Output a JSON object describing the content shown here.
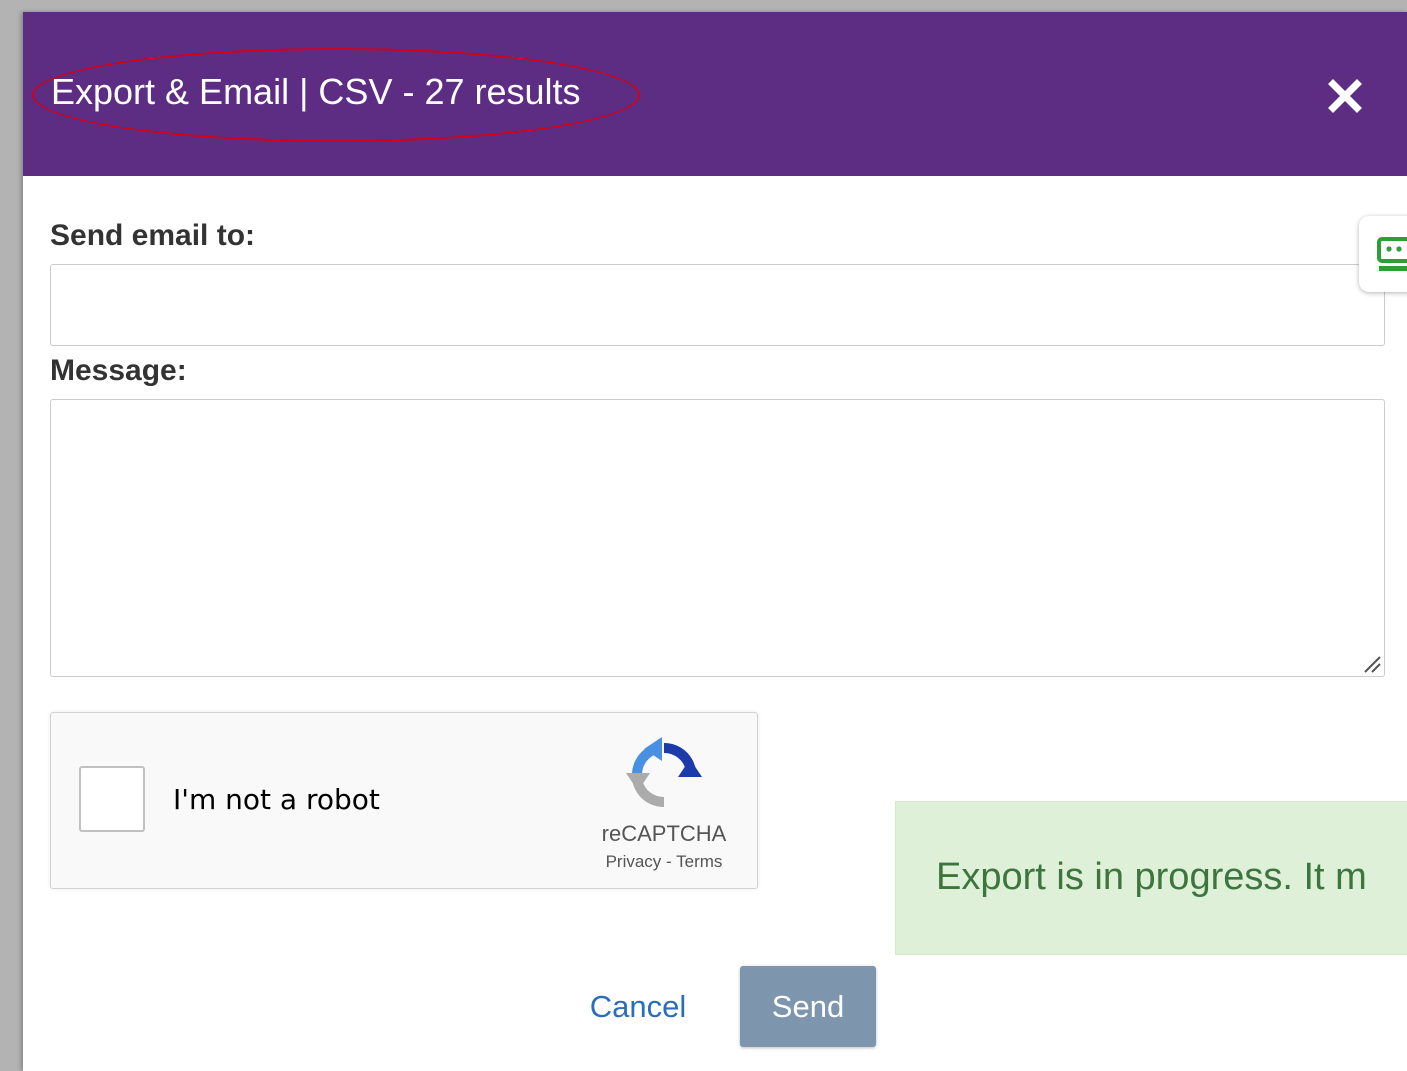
{
  "dialog": {
    "title": "Export & Email | CSV - 27 results",
    "accent_color": "#5c2d82",
    "close_icon": "close-icon"
  },
  "form": {
    "email_label": "Send email to:",
    "email_value": "",
    "email_placeholder": "",
    "message_label": "Message:",
    "message_value": "",
    "message_placeholder": ""
  },
  "recaptcha": {
    "label": "I'm not a robot",
    "brand": "reCAPTCHA",
    "privacy": "Privacy",
    "separator": "-",
    "terms": "Terms"
  },
  "alert": {
    "text": "Export is in progress. It m",
    "color": "#3c763d"
  },
  "actions": {
    "cancel_label": "Cancel",
    "send_label": "Send"
  }
}
